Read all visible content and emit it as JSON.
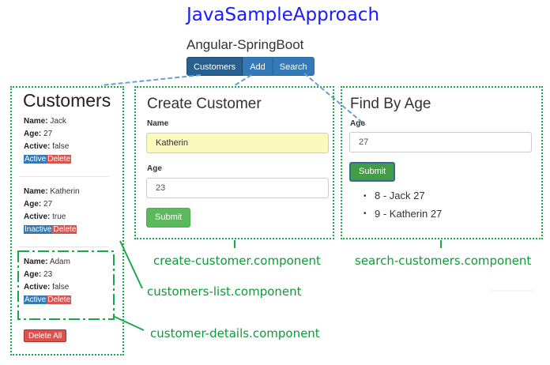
{
  "header": {
    "title": "JavaSampleApproach",
    "subtitle": "Angular-SpringBoot"
  },
  "nav": {
    "items": [
      {
        "label": "Customers"
      },
      {
        "label": "Add"
      },
      {
        "label": "Search"
      }
    ]
  },
  "customers_list": {
    "title": "Customers",
    "name_key": "Name:",
    "age_key": "Age:",
    "active_key": "Active:",
    "customers": [
      {
        "name": "Jack",
        "age": "27",
        "active": "false",
        "status_badge": "Active",
        "delete_badge": "Delete"
      },
      {
        "name": "Katherin",
        "age": "27",
        "active": "true",
        "status_badge": "Inactive",
        "delete_badge": "Delete"
      },
      {
        "name": "Adam",
        "age": "23",
        "active": "false",
        "status_badge": "Active",
        "delete_badge": "Delete"
      }
    ],
    "delete_all_label": "Delete All"
  },
  "create_customer": {
    "title": "Create Customer",
    "name_label": "Name",
    "name_value": "Katherin",
    "age_label": "Age",
    "age_value": "23",
    "submit_label": "Submit"
  },
  "search_by_age": {
    "title": "Find By Age",
    "age_label": "Age",
    "age_value": "27",
    "submit_label": "Submit",
    "results": [
      {
        "id": "8",
        "separator": " - ",
        "text": "Jack 27"
      },
      {
        "id": "9",
        "separator": " - ",
        "text": "Katherin 27"
      }
    ]
  },
  "annotations": {
    "create": "create-customer.component",
    "search": "search-customers.component",
    "list": "customers-list.component",
    "details": "customer-details.component"
  },
  "colors": {
    "title_blue": "#1a1aff",
    "annotation_green": "#0f9a3a",
    "box_green": "#19a84a",
    "connector_blue": "#6a9fd4",
    "primary": "#337ab7",
    "danger": "#d9534f",
    "success": "#5cb85c"
  }
}
